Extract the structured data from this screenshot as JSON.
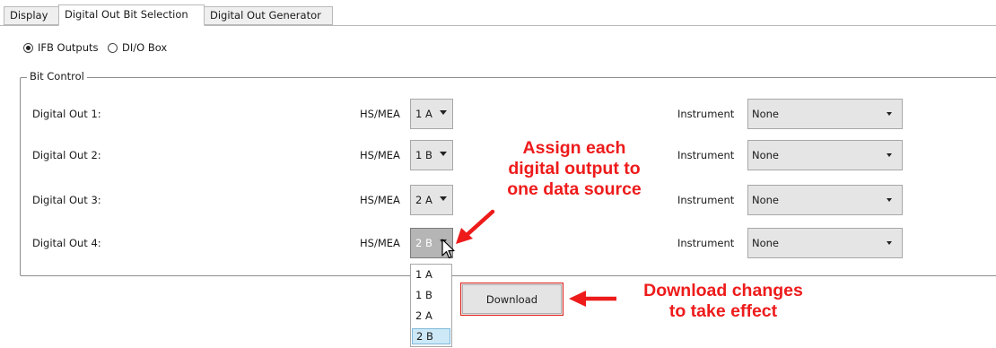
{
  "tabs": [
    {
      "label": "Display"
    },
    {
      "label": "Digital Out Bit Selection"
    },
    {
      "label": "Digital Out Generator"
    }
  ],
  "output_type": {
    "options": [
      "IFB Outputs",
      "DI/O Box"
    ],
    "selected": "IFB Outputs"
  },
  "bit_control": {
    "title": "Bit Control",
    "hs_label": "HS/MEA",
    "instrument_label": "Instrument",
    "rows": [
      {
        "label": "Digital Out 1:",
        "hs_value": "1 A",
        "instrument_value": "None"
      },
      {
        "label": "Digital Out 2:",
        "hs_value": "1 B",
        "instrument_value": "None"
      },
      {
        "label": "Digital Out 3:",
        "hs_value": "2 A",
        "instrument_value": "None"
      },
      {
        "label": "Digital Out 4:",
        "hs_value": "2 B",
        "instrument_value": "None"
      }
    ]
  },
  "dropdown": {
    "options": [
      "1 A",
      "1 B",
      "2 A",
      "2 B"
    ],
    "highlighted": "2 B"
  },
  "download_label": "Download",
  "annotations": {
    "assign": [
      "Assign each",
      "digital output to",
      "one data source"
    ],
    "download": [
      "Download changes",
      "to take effect"
    ],
    "color": "#ee1b1b"
  }
}
